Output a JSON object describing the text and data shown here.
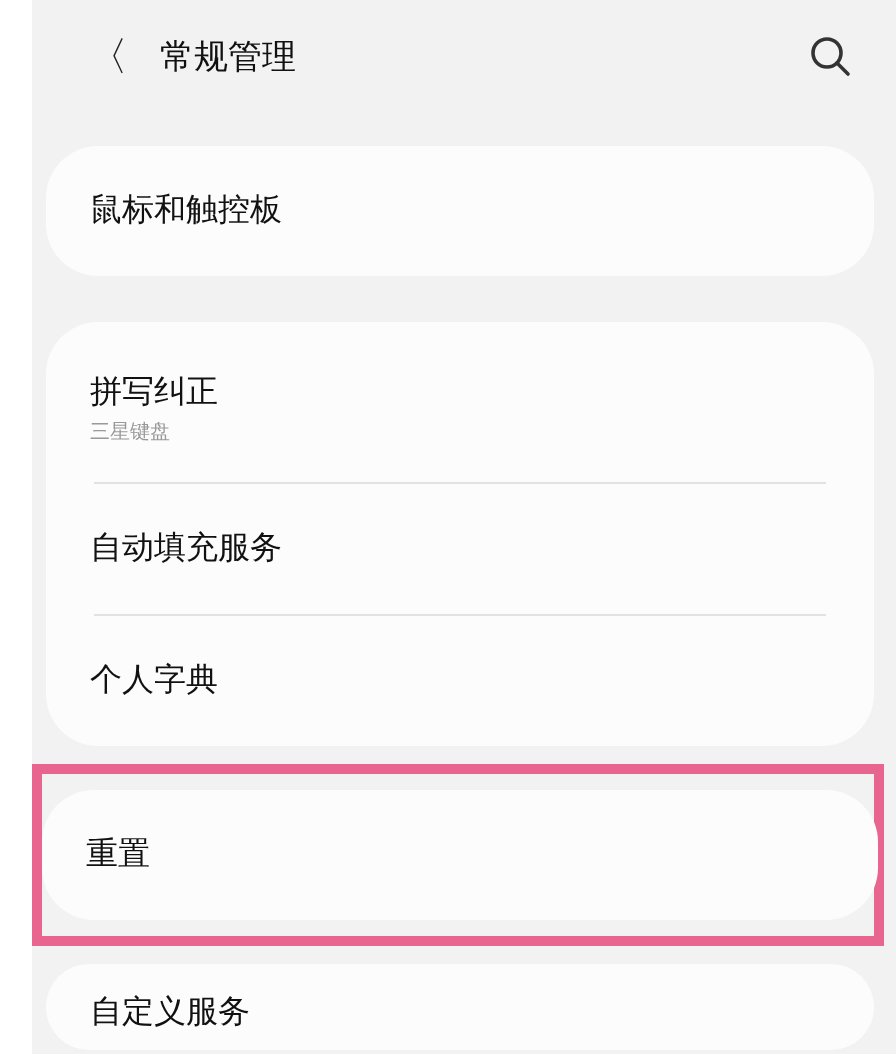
{
  "header": {
    "back": "〈",
    "title": "常规管理"
  },
  "groups": [
    {
      "highlighted": false,
      "items": [
        {
          "label": "鼠标和触控板"
        }
      ]
    },
    {
      "highlighted": false,
      "items": [
        {
          "label": "拼写纠正",
          "subtitle": "三星键盘"
        },
        {
          "label": "自动填充服务"
        },
        {
          "label": "个人字典"
        }
      ]
    },
    {
      "highlighted": true,
      "items": [
        {
          "label": "重置"
        }
      ]
    },
    {
      "highlighted": false,
      "items": [
        {
          "label": "自定义服务"
        }
      ]
    }
  ]
}
